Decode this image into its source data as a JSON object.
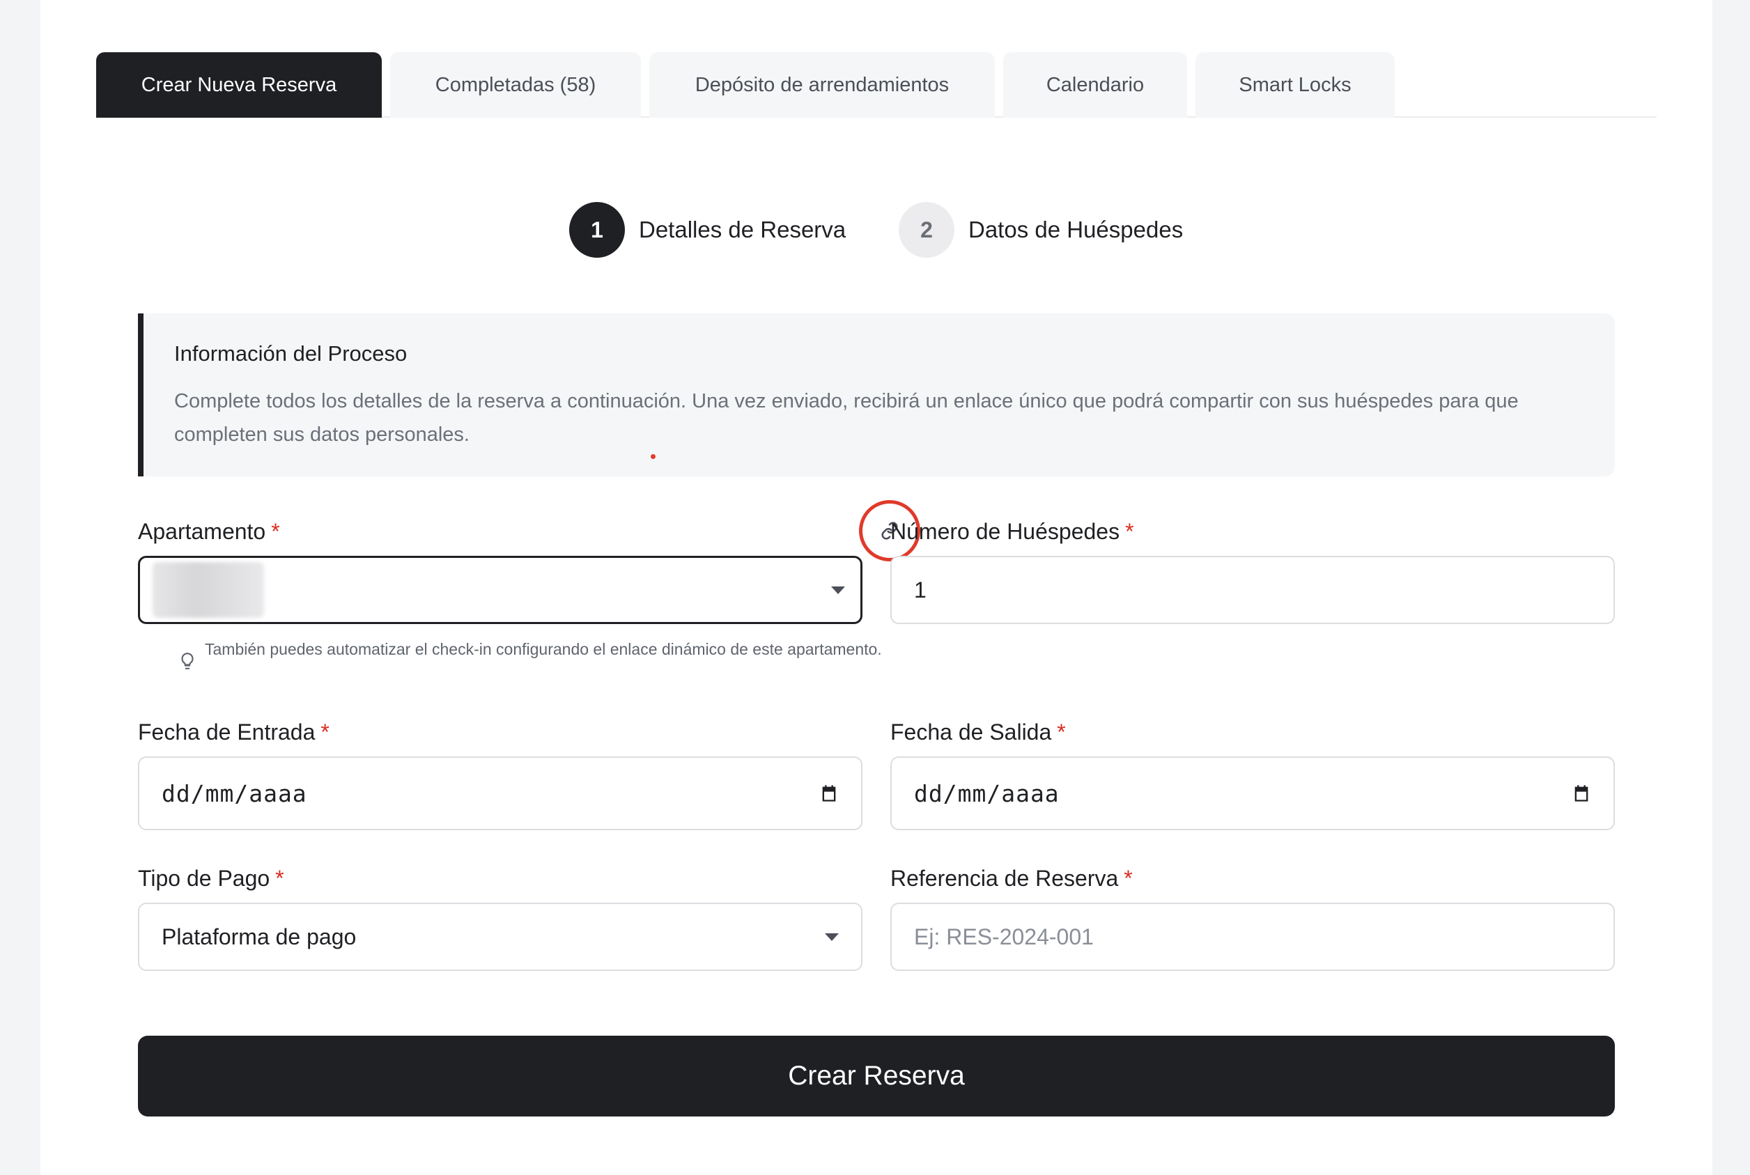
{
  "tabs": [
    {
      "label": "Crear Nueva Reserva",
      "active": true
    },
    {
      "label": "Completadas (58)",
      "active": false
    },
    {
      "label": "Depósito de arrendamientos",
      "active": false
    },
    {
      "label": "Calendario",
      "active": false
    },
    {
      "label": "Smart Locks",
      "active": false
    }
  ],
  "stepper": [
    {
      "number": "1",
      "label": "Detalles de Reserva",
      "active": true
    },
    {
      "number": "2",
      "label": "Datos de Huéspedes",
      "active": false
    }
  ],
  "info": {
    "title": "Información del Proceso",
    "text": "Complete todos los detalles de la reserva a continuación. Una vez enviado, recibirá un enlace único que podrá compartir con sus huéspedes para que completen sus datos personales."
  },
  "form": {
    "required_mark": "*",
    "apartment": {
      "label": "Apartamento",
      "value": ""
    },
    "apartment_hint": "También puedes automatizar el check-in configurando el enlace dinámico de este apartamento.",
    "guests": {
      "label": "Número de Huéspedes",
      "value": "1"
    },
    "checkin": {
      "label": "Fecha de Entrada",
      "value": "dd/mm/aaaa"
    },
    "checkout": {
      "label": "Fecha de Salida",
      "value": "dd/mm/aaaa"
    },
    "payment_type": {
      "label": "Tipo de Pago",
      "value": "Plataforma de pago"
    },
    "reference": {
      "label": "Referencia de Reserva",
      "placeholder": "Ej: RES-2024-001"
    },
    "submit_label": "Crear Reserva"
  },
  "colors": {
    "primary": "#1f2023",
    "required": "#d92d20",
    "highlight": "#e03a2a"
  }
}
